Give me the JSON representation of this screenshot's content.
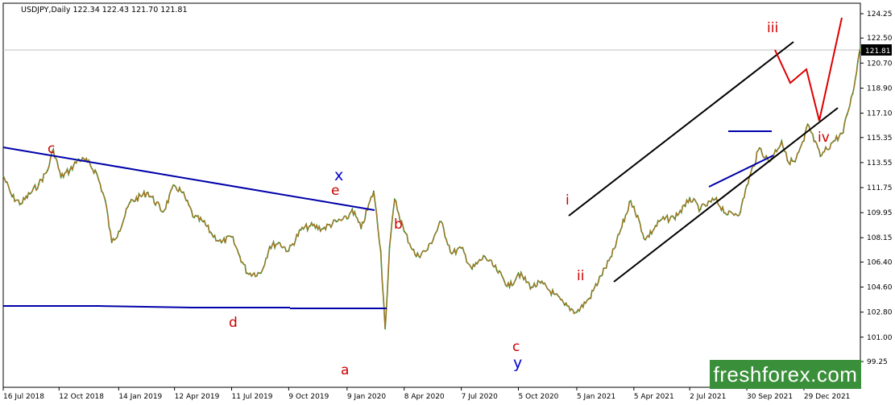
{
  "chart_data": {
    "type": "line",
    "header": "USDJPY,Daily  122.34 122.43 121.70 121.81",
    "symbol": "USDJPY",
    "timeframe": "Daily",
    "ohlc": {
      "open": 122.34,
      "high": 122.43,
      "low": 121.7,
      "close": 121.81
    },
    "current_price_label": "121.81",
    "y_axis": {
      "ticks": [
        "124.25",
        "122.50",
        "120.70",
        "118.90",
        "117.10",
        "115.35",
        "113.55",
        "111.75",
        "109.95",
        "108.15",
        "106.40",
        "104.60",
        "102.80",
        "101.00",
        "99.25"
      ],
      "ylim": [
        99.25,
        124.25
      ]
    },
    "x_axis": {
      "ticks": [
        "16 Jul 2018",
        "12 Oct 2018",
        "14 Jan 2019",
        "12 Apr 2019",
        "11 Jul 2019",
        "9 Oct 2019",
        "9 Jan 2020",
        "8 Apr 2020",
        "7 Jul 2020",
        "5 Oct 2020",
        "5 Jan 2021",
        "5 Apr 2021",
        "2 Jul 2021",
        "30 Sep 2021",
        "29 Dec 2021"
      ],
      "xlim": [
        "2018-07-16",
        "2022-03-28"
      ]
    },
    "grid": false,
    "series": [
      {
        "color": "#d2691e",
        "x": [
          "2018-07-16",
          "2018-07-30",
          "2018-08-13",
          "2018-08-27",
          "2018-09-10",
          "2018-09-24",
          "2018-10-03",
          "2018-10-15",
          "2018-10-29",
          "2018-11-12",
          "2018-11-26",
          "2018-12-10",
          "2018-12-24",
          "2019-01-03",
          "2019-01-14",
          "2019-02-01",
          "2019-03-01",
          "2019-03-25",
          "2019-04-12",
          "2019-04-24",
          "2019-05-13",
          "2019-05-27",
          "2019-06-10",
          "2019-06-25",
          "2019-07-11",
          "2019-07-24",
          "2019-08-05",
          "2019-08-26",
          "2019-09-09",
          "2019-09-23",
          "2019-10-09",
          "2019-10-28",
          "2019-11-12",
          "2019-12-02",
          "2019-12-23",
          "2020-01-09",
          "2020-01-17",
          "2020-01-31",
          "2020-02-20",
          "2020-03-02",
          "2020-03-09",
          "2020-03-16",
          "2020-03-24",
          "2020-04-08",
          "2020-04-27",
          "2020-05-15",
          "2020-06-05",
          "2020-06-22",
          "2020-07-07",
          "2020-07-24",
          "2020-08-13",
          "2020-09-01",
          "2020-09-21",
          "2020-10-05",
          "2020-10-26",
          "2020-11-09",
          "2020-11-30",
          "2020-12-17",
          "2021-01-05",
          "2021-01-25",
          "2021-02-12",
          "2021-03-01",
          "2021-03-31",
          "2021-04-05",
          "2021-04-23",
          "2021-05-17",
          "2021-06-07",
          "2021-06-25",
          "2021-07-02",
          "2021-07-19",
          "2021-08-11",
          "2021-08-31",
          "2021-09-20",
          "2021-09-30",
          "2021-10-20",
          "2021-11-04",
          "2021-11-24",
          "2021-12-03",
          "2021-12-15",
          "2021-12-29",
          "2022-01-04",
          "2022-01-24",
          "2022-02-14",
          "2022-03-01",
          "2022-03-07",
          "2022-03-16",
          "2022-03-24",
          "2022-03-28"
        ],
        "values": [
          112.6,
          111.1,
          110.6,
          111.3,
          112.0,
          113.0,
          114.5,
          112.5,
          113.0,
          113.8,
          113.6,
          112.8,
          110.8,
          107.8,
          108.6,
          110.7,
          111.4,
          110.0,
          111.9,
          111.4,
          109.6,
          109.3,
          108.4,
          107.8,
          108.2,
          106.8,
          105.6,
          105.6,
          107.5,
          107.8,
          107.2,
          108.7,
          109.0,
          108.8,
          109.3,
          109.5,
          110.2,
          108.8,
          111.5,
          107.2,
          101.6,
          107.5,
          110.9,
          108.6,
          106.8,
          107.3,
          109.3,
          107.0,
          107.4,
          105.9,
          106.8,
          105.8,
          104.6,
          105.6,
          104.6,
          104.9,
          104.1,
          103.3,
          102.8,
          103.8,
          105.4,
          106.8,
          110.8,
          110.4,
          108.0,
          109.4,
          109.6,
          110.4,
          111.0,
          110.2,
          110.9,
          109.8,
          110.0,
          111.9,
          114.6,
          113.6,
          115.1,
          113.7,
          113.6,
          115.1,
          116.3,
          114.0,
          115.1,
          115.7,
          117.0,
          118.5,
          120.8,
          121.8
        ]
      }
    ],
    "wave_labels": [
      "c",
      "x",
      "e",
      "d",
      "a",
      "b",
      "i",
      "ii",
      "c",
      "y",
      "iii",
      "iv"
    ],
    "watermark": "freshforex.com"
  }
}
